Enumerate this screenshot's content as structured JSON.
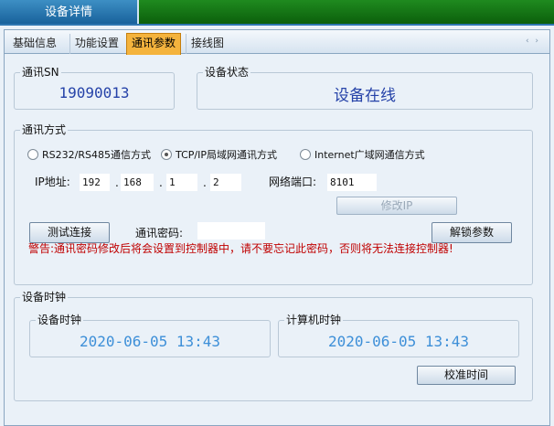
{
  "window": {
    "title": "设备详情"
  },
  "tabs": [
    {
      "label": "基础信息"
    },
    {
      "label": "功能设置"
    },
    {
      "label": "通讯参数"
    },
    {
      "label": "接线图"
    }
  ],
  "tab_arrows": "‹ ›",
  "sn": {
    "legend": "通讯SN",
    "value": "19090013"
  },
  "status": {
    "legend": "设备状态",
    "value": "设备在线"
  },
  "comm": {
    "legend": "通讯方式",
    "options": [
      {
        "label": "RS232/RS485通信方式",
        "selected": false
      },
      {
        "label": "TCP/IP局域网通讯方式",
        "selected": true
      },
      {
        "label": "Internet广域网通信方式",
        "selected": false
      }
    ],
    "ip_label": "IP地址:",
    "ip": [
      "192",
      "168",
      "1",
      "2"
    ],
    "port_label": "网络端口:",
    "port": "8101",
    "modify_ip_label": "修改IP",
    "test_label": "测试连接",
    "password_label": "通讯密码:",
    "password": "",
    "unlock_label": "解锁参数",
    "warning": "警告:通讯密码修改后将会设置到控制器中，请不要忘记此密码，否则将无法连接控制器!"
  },
  "clock": {
    "legend": "设备时钟",
    "device_legend": "设备时钟",
    "device_time": "2020-06-05 13:43",
    "computer_legend": "计算机时钟",
    "computer_time": "2020-06-05 13:43",
    "sync_label": "校准时间"
  },
  "colors": {
    "value_blue": "#2542a8",
    "clock_blue": "#3d8fd8",
    "warning_red": "#c00000",
    "active_tab": "#f4b33d",
    "title_bar": "#1f8a1f"
  }
}
